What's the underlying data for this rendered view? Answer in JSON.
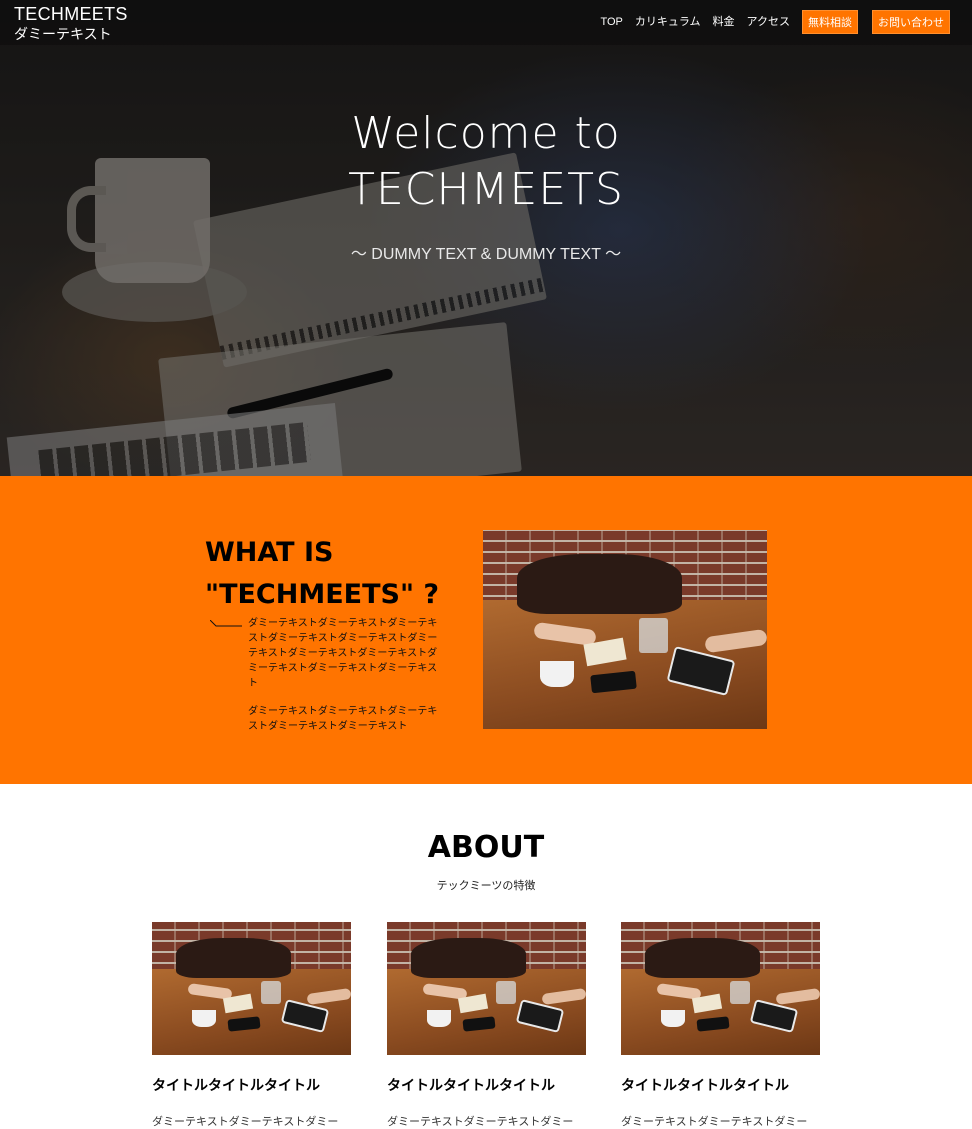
{
  "header": {
    "logo_main": "TECHMEETS",
    "logo_sub": "ダミーテキスト",
    "nav": [
      {
        "label": "TOP"
      },
      {
        "label": "カリキュラム"
      },
      {
        "label": "料金"
      },
      {
        "label": "アクセス"
      }
    ],
    "cta_primary": "無料相談",
    "cta_secondary": "お問い合わせ",
    "accent_color": "#ff7400"
  },
  "hero": {
    "title_line1": "Welcome to",
    "title_line2": "TECHMEETS",
    "subtitle": "〜 DUMMY TEXT & DUMMY TEXT 〜"
  },
  "what": {
    "title_line1": "WHAT IS",
    "title_line2": "\"TECHMEETS\" ?",
    "body1": "ダミーテキストダミーテキストダミーテキストダミーテキストダミーテキストダミーテキストダミーテキストダミーテキストダミーテキストダミーテキストダミーテキスト",
    "body2": "ダミーテキストダミーテキストダミーテキストダミーテキストダミーテキスト",
    "background_color": "#ff7400"
  },
  "about": {
    "title": "ABOUT",
    "subtitle": "テックミーツの特徴",
    "cards": [
      {
        "title": "タイトルタイトルタイトル",
        "text": "ダミーテキストダミーテキストダミー"
      },
      {
        "title": "タイトルタイトルタイトル",
        "text": "ダミーテキストダミーテキストダミー"
      },
      {
        "title": "タイトルタイトルタイトル",
        "text": "ダミーテキストダミーテキストダミー"
      }
    ]
  }
}
